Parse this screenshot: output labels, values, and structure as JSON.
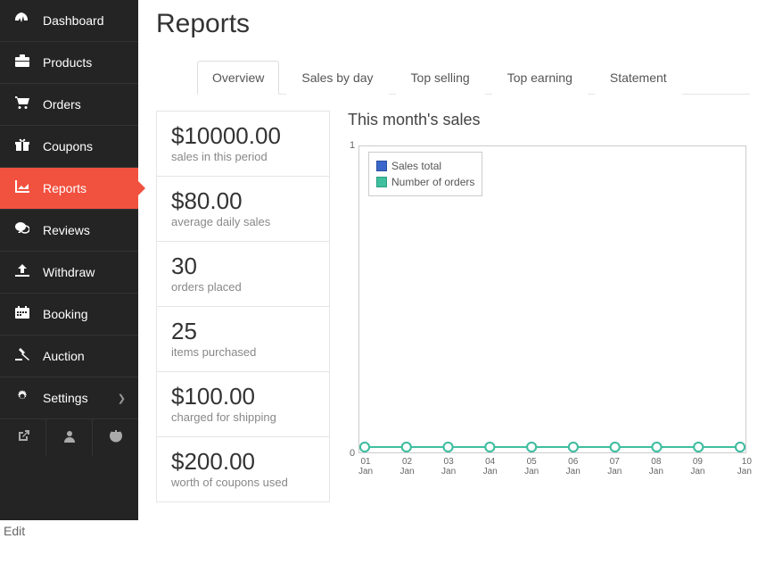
{
  "sidebar": {
    "items": [
      {
        "icon": "dashboard",
        "label": "Dashboard"
      },
      {
        "icon": "products",
        "label": "Products"
      },
      {
        "icon": "orders",
        "label": "Orders"
      },
      {
        "icon": "coupons",
        "label": "Coupons"
      },
      {
        "icon": "reports",
        "label": "Reports",
        "active": true
      },
      {
        "icon": "reviews",
        "label": "Reviews"
      },
      {
        "icon": "withdraw",
        "label": "Withdraw"
      },
      {
        "icon": "booking",
        "label": "Booking"
      },
      {
        "icon": "auction",
        "label": "Auction"
      },
      {
        "icon": "settings",
        "label": "Settings",
        "has_submenu": true
      }
    ],
    "bottom_icons": [
      "external-link",
      "user",
      "power"
    ]
  },
  "page": {
    "title": "Reports",
    "tabs": [
      {
        "label": "Overview",
        "active": true
      },
      {
        "label": "Sales by day"
      },
      {
        "label": "Top selling"
      },
      {
        "label": "Top earning"
      },
      {
        "label": "Statement"
      }
    ],
    "stats": [
      {
        "value": "$10000.00",
        "label": "sales in this period"
      },
      {
        "value": "$80.00",
        "label": "average daily sales"
      },
      {
        "value": "30",
        "label": "orders placed"
      },
      {
        "value": "25",
        "label": "items purchased"
      },
      {
        "value": "$100.00",
        "label": "charged for shipping"
      },
      {
        "value": "$200.00",
        "label": "worth of coupons used"
      }
    ],
    "chart_title": "This month's sales",
    "legend": {
      "sales_total": "Sales total",
      "number_of_orders": "Number of orders"
    },
    "edit": "Edit"
  },
  "chart_data": {
    "type": "line",
    "title": "This month's sales",
    "x": [
      "01 Jan",
      "02 Jan",
      "03 Jan",
      "04 Jan",
      "05 Jan",
      "06 Jan",
      "07 Jan",
      "08 Jan",
      "09 Jan",
      "10 Jan"
    ],
    "series": [
      {
        "name": "Sales total",
        "values": [
          0,
          0,
          0,
          0,
          0,
          0,
          0,
          0,
          0,
          0
        ],
        "color": "#3a67c9"
      },
      {
        "name": "Number of orders",
        "values": [
          0,
          0,
          0,
          0,
          0,
          0,
          0,
          0,
          0,
          0
        ],
        "color": "#3fbf9e"
      }
    ],
    "ylim": [
      0,
      1
    ],
    "ylabel": "",
    "xlabel": ""
  }
}
